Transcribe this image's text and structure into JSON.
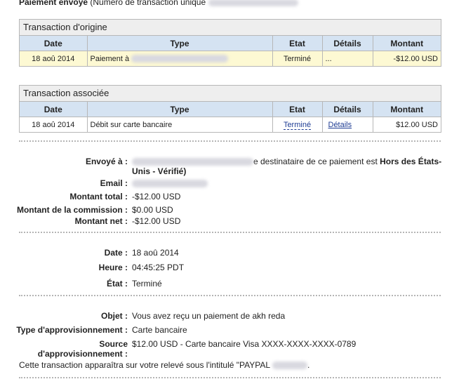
{
  "header": {
    "title_bold": "Paiement envoyé",
    "title_rest": "(Numéro de transaction unique"
  },
  "original": {
    "caption": "Transaction d'origine",
    "columns": [
      "Date",
      "Type",
      "Etat",
      "Détails",
      "Montant"
    ],
    "row": {
      "date": "18 aoû 2014",
      "type": "Paiement à",
      "status": "Terminé",
      "details": "...",
      "amount": "-$12.00 USD"
    }
  },
  "associated": {
    "caption": "Transaction associée",
    "columns": [
      "Date",
      "Type",
      "Etat",
      "Détails",
      "Montant"
    ],
    "row": {
      "date": "18 aoû 2014",
      "type": "Débit sur carte bancaire",
      "status": "Terminé",
      "details": "Détails",
      "amount": "$12.00 USD"
    }
  },
  "payment": {
    "sent_to_label": "Envoyé à :",
    "sent_to_text": "e destinataire de ce paiement est",
    "sent_to_bold": "Hors des États-",
    "sent_to_bold2": "Unis - Vérifié)",
    "email_label": "Email :",
    "total_label": "Montant total :",
    "total_value": "-$12.00 USD",
    "fee_label": "Montant de la commission :",
    "fee_value": "$0.00 USD",
    "net_label": "Montant net :",
    "net_value": "-$12.00 USD"
  },
  "timing": {
    "date_label": "Date :",
    "date_value": "18 aoû 2014",
    "time_label": "Heure :",
    "time_value": "04:45:25 PDT",
    "state_label": "État :",
    "state_value": "Terminé"
  },
  "funding": {
    "subject_label": "Objet :",
    "subject_value": "Vous avez reçu un paiement de akh reda",
    "type_label": "Type d'approvisionnement :",
    "type_value": "Carte bancaire",
    "source_label": "Source",
    "source_label2": "d'approvisionnement :",
    "source_value": "$12.00 USD - Carte bancaire Visa XXXX-XXXX-XXXX-0789",
    "statement_note": "Cette transaction apparaîtra sur votre relevé sous l'intitulé \"PAYPAL",
    "statement_end": "."
  }
}
